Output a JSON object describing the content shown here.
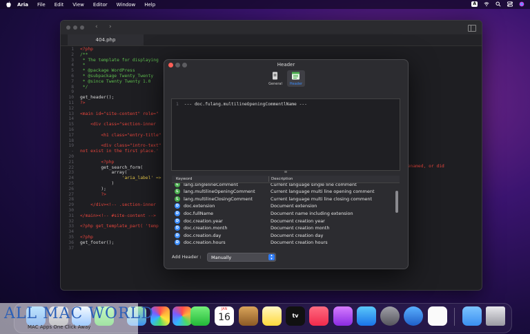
{
  "menubar": {
    "app": "Aria",
    "items": [
      "File",
      "Edit",
      "View",
      "Editor",
      "Window",
      "Help"
    ],
    "input_badge": "A"
  },
  "editor": {
    "tab": "404.php",
    "lines": [
      {
        "n": "1",
        "t": "<?php"
      },
      {
        "n": "2",
        "t": "/**"
      },
      {
        "n": "3",
        "t": " * The template for displaying "
      },
      {
        "n": "4",
        "t": " *"
      },
      {
        "n": "5",
        "t": " * @package WordPress"
      },
      {
        "n": "6",
        "t": " * @subpackage Twenty_Twenty"
      },
      {
        "n": "7",
        "t": " * @since Twenty Twenty 1.0"
      },
      {
        "n": "8",
        "t": " */"
      },
      {
        "n": "9",
        "t": ""
      },
      {
        "n": "10",
        "t": "get_header();"
      },
      {
        "n": "11",
        "t": "?>"
      },
      {
        "n": "12",
        "t": ""
      },
      {
        "n": "13",
        "t": "<main id=\"site-content\" role=\""
      },
      {
        "n": "14",
        "t": ""
      },
      {
        "n": "15",
        "t": "    <div class=\"section-inner "
      },
      {
        "n": "16",
        "t": ""
      },
      {
        "n": "17",
        "t": "        <h1 class=\"entry-title\""
      },
      {
        "n": "18",
        "t": ""
      },
      {
        "n": "19",
        "t": "        <div class=\"intro-text\""
      },
      {
        "n": "-",
        "t": "not exist in the first place.'"
      },
      {
        "n": "20",
        "t": ""
      },
      {
        "n": "21",
        "t": "        <?php"
      },
      {
        "n": "22",
        "t": "        get_search_form("
      },
      {
        "n": "23",
        "t": "            array("
      },
      {
        "n": "24",
        "t": "                'aria_label' =>"
      },
      {
        "n": "25",
        "t": "            )"
      },
      {
        "n": "26",
        "t": "        );"
      },
      {
        "n": "27",
        "t": "        ?>"
      },
      {
        "n": "28",
        "t": ""
      },
      {
        "n": "29",
        "t": "    </div><!-- .section-inner "
      },
      {
        "n": "30",
        "t": ""
      },
      {
        "n": "31",
        "t": "</main><!-- #site-content -->"
      },
      {
        "n": "32",
        "t": ""
      },
      {
        "n": "33",
        "t": "<?php get_template_part( 'temp"
      },
      {
        "n": "34",
        "t": ""
      },
      {
        "n": "35",
        "t": "<?php"
      },
      {
        "n": "36",
        "t": "get_footer();"
      },
      {
        "n": "37",
        "t": ""
      }
    ],
    "overflow_text": "ved, renamed, or did"
  },
  "dialog": {
    "title": "Header",
    "toolbar": [
      {
        "label": "General"
      },
      {
        "label": "Header"
      }
    ],
    "editor_line_number": "1",
    "editor_line": "--- doc.fulang.multilineOpeningCommentlName ---",
    "table_headers": {
      "keyword": "Keyword",
      "description": "Description"
    },
    "rows": [
      {
        "badge": "L",
        "kw": "lang.singlelineComment",
        "desc": "Current language single line comment"
      },
      {
        "badge": "L",
        "kw": "lang.multilineOpeningComment",
        "desc": "Current language multi line opening comment"
      },
      {
        "badge": "L",
        "kw": "lang.multilineClosingComment",
        "desc": "Current language multi line closing comment"
      },
      {
        "badge": "D",
        "kw": "doc.extension",
        "desc": "Document extension"
      },
      {
        "badge": "D",
        "kw": "doc.fullName",
        "desc": "Document name including extension"
      },
      {
        "badge": "D",
        "kw": "doc.creation.year",
        "desc": "Document creation year"
      },
      {
        "badge": "D",
        "kw": "doc.creation.month",
        "desc": "Document creation month"
      },
      {
        "badge": "D",
        "kw": "doc.creation.day",
        "desc": "Document creation day"
      },
      {
        "badge": "D",
        "kw": "doc.creation.hours",
        "desc": "Document creation hours"
      }
    ],
    "add_header_label": "Add Header :",
    "add_header_value": "Manually"
  },
  "dock": {
    "calendar_month": "JAN",
    "calendar_day": "16",
    "tv_label": "tv"
  },
  "watermark": {
    "title": "ALL MAC WORLD",
    "subtitle": "MAC Apps One Click Away"
  },
  "colors": {
    "accent": "#2f7cf6",
    "lang_badge": "#4caf50",
    "doc_badge": "#3b8dfd"
  }
}
